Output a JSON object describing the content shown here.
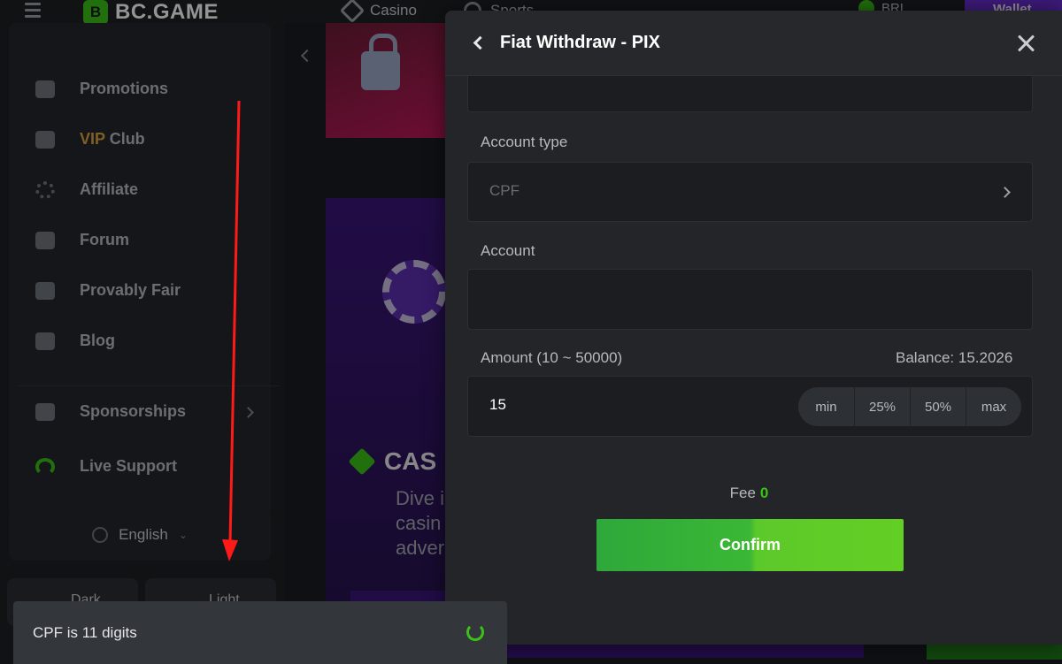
{
  "header": {
    "logo_text": "BC.GAME",
    "casino_link": "Casino",
    "sports_link": "Sports",
    "currency": "BRL",
    "wallet_label": "Wallet"
  },
  "sidebar": {
    "items": [
      {
        "label": "Promotions",
        "icon": "gift-icon"
      },
      {
        "label_prefix": "VIP",
        "label_suffix": " Club",
        "icon": "crown-icon"
      },
      {
        "label": "Affiliate",
        "icon": "affiliate-icon"
      },
      {
        "label": "Forum",
        "icon": "forum-icon"
      },
      {
        "label": "Provably Fair",
        "icon": "provably-fair-icon"
      },
      {
        "label": "Blog",
        "icon": "blog-icon"
      },
      {
        "label": "Sponsorships",
        "icon": "handshake-icon"
      },
      {
        "label": "Live Support",
        "icon": "headset-icon"
      }
    ],
    "language": "English",
    "theme_dark": "Dark",
    "theme_light": "Light"
  },
  "content": {
    "casino_title": "CAS",
    "casino_desc_lines": [
      "Dive i",
      "casin",
      "adver"
    ]
  },
  "modal": {
    "title": "Fiat Withdraw - PIX",
    "account_type_label": "Account type",
    "account_type_value": "CPF",
    "account_label": "Account",
    "account_value": "",
    "amount_label": "Amount (10 ~ 50000)",
    "balance_label": "Balance: 15.2026",
    "amount_value": "15",
    "quick_buttons": [
      "min",
      "25%",
      "50%",
      "max"
    ],
    "fee_label": "Fee",
    "fee_value": "0",
    "confirm_label": "Confirm"
  },
  "toast": {
    "message": "CPF is 11 digits"
  },
  "colors": {
    "accent_green": "#3bc117",
    "modal_bg": "#232529",
    "annotation_red": "#ff0000"
  }
}
